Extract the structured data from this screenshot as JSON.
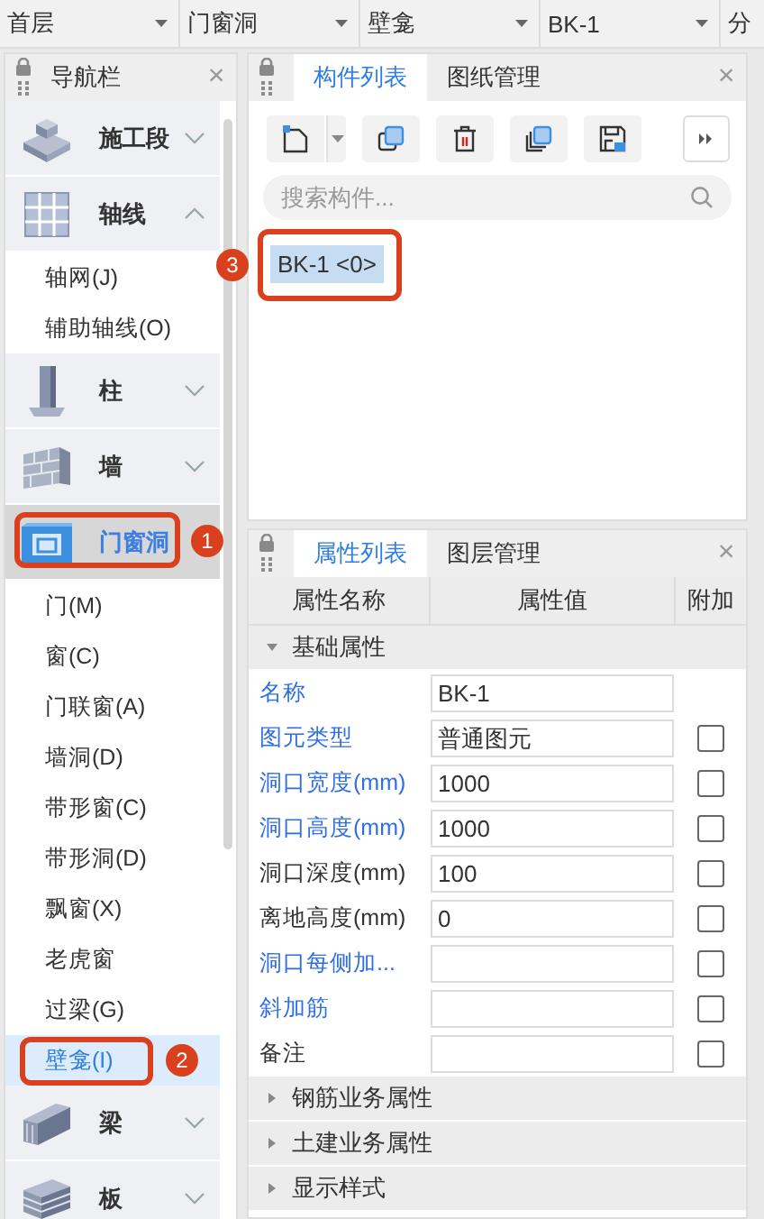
{
  "top_bar": {
    "selectors": [
      {
        "value": "首层"
      },
      {
        "value": "门窗洞"
      },
      {
        "value": "壁龛"
      },
      {
        "value": "BK-1"
      },
      {
        "value": "分"
      }
    ]
  },
  "nav": {
    "title": "导航栏",
    "close": "×",
    "items": [
      {
        "kind": "segment",
        "label": "施工段",
        "expanded": false,
        "selected": false
      },
      {
        "kind": "axis",
        "label": "轴线",
        "expanded": true,
        "selected": false,
        "children": [
          {
            "label": "轴网(J)",
            "selected": false
          },
          {
            "label": "辅助轴线(O)",
            "selected": false
          }
        ]
      },
      {
        "kind": "column",
        "label": "柱",
        "expanded": false,
        "selected": false
      },
      {
        "kind": "wall",
        "label": "墙",
        "expanded": false,
        "selected": false
      },
      {
        "kind": "opening",
        "label": "门窗洞",
        "expanded": true,
        "selected": true,
        "callout": "1",
        "children": [
          {
            "label": "门(M)",
            "selected": false
          },
          {
            "label": "窗(C)",
            "selected": false
          },
          {
            "label": "门联窗(A)",
            "selected": false
          },
          {
            "label": "墙洞(D)",
            "selected": false
          },
          {
            "label": "带形窗(C)",
            "selected": false
          },
          {
            "label": "带形洞(D)",
            "selected": false
          },
          {
            "label": "飘窗(X)",
            "selected": false
          },
          {
            "label": "老虎窗",
            "selected": false
          },
          {
            "label": "过梁(G)",
            "selected": false
          },
          {
            "label": "壁龛(I)",
            "selected": true,
            "callout": "2"
          }
        ]
      },
      {
        "kind": "beam",
        "label": "梁",
        "expanded": false,
        "selected": false
      },
      {
        "kind": "slab",
        "label": "板",
        "expanded": false,
        "selected": false
      }
    ]
  },
  "component_panel": {
    "tabs": [
      {
        "label": "构件列表",
        "selected": true
      },
      {
        "label": "图纸管理",
        "selected": false
      }
    ],
    "close": "×",
    "toolbar": [
      {
        "kind": "new"
      },
      {
        "kind": "copy"
      },
      {
        "kind": "delete"
      },
      {
        "kind": "copy-floor"
      },
      {
        "kind": "save"
      },
      {
        "kind": "more"
      }
    ],
    "search": {
      "placeholder": "搜索构件..."
    },
    "components": [
      {
        "label": "BK-1 <0>",
        "selected": true,
        "callout": "3"
      }
    ]
  },
  "property_panel": {
    "tabs": [
      {
        "label": "属性列表",
        "selected": true
      },
      {
        "label": "图层管理",
        "selected": false
      }
    ],
    "close": "×",
    "columns": [
      "属性名称",
      "属性值",
      "附加"
    ],
    "groups": [
      {
        "label": "基础属性",
        "expanded": true,
        "rows": [
          {
            "kind": "field",
            "name": "名称",
            "value": "BK-1",
            "highlighted": true
          },
          {
            "kind": "field-check",
            "name": "图元类型",
            "value": "普通图元",
            "highlighted": true,
            "checked": false
          },
          {
            "kind": "field-check",
            "name": "洞口宽度(mm)",
            "value": "1000",
            "highlighted": true,
            "checked": false
          },
          {
            "kind": "field-check",
            "name": "洞口高度(mm)",
            "value": "1000",
            "highlighted": true,
            "checked": false
          },
          {
            "kind": "field-check",
            "name": "洞口深度(mm)",
            "value": "100",
            "highlighted": false,
            "checked": false
          },
          {
            "kind": "field-check",
            "name": "离地高度(mm)",
            "value": "0",
            "highlighted": false,
            "checked": false
          },
          {
            "kind": "field-check",
            "name": "洞口每侧加...",
            "highlighted": true,
            "checked": false
          },
          {
            "kind": "field-check",
            "name": "斜加筋",
            "highlighted": true,
            "checked": false
          },
          {
            "kind": "field-check",
            "name": "备注",
            "highlighted": false,
            "checked": false
          }
        ]
      },
      {
        "label": "钢筋业务属性",
        "expanded": false
      },
      {
        "label": "土建业务属性",
        "expanded": false
      },
      {
        "label": "显示样式",
        "expanded": false
      }
    ]
  }
}
